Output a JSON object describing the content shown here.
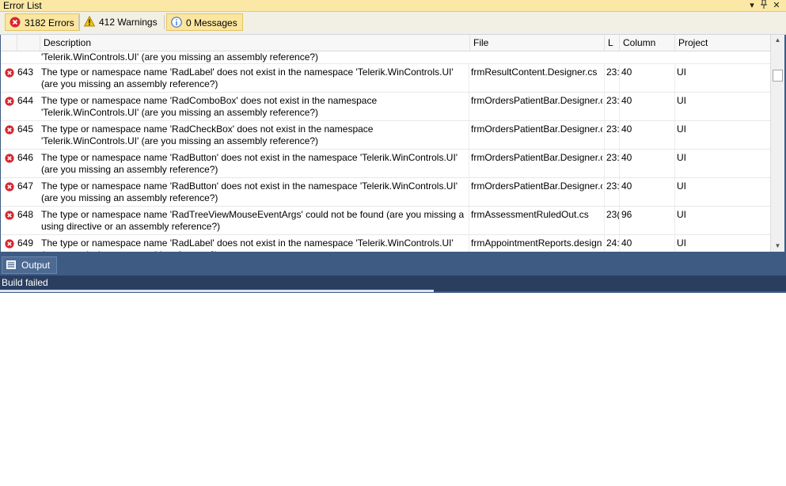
{
  "window": {
    "title": "Error List"
  },
  "toolbar": {
    "errors_label": "3182 Errors",
    "warnings_label": "412 Warnings",
    "messages_label": "0 Messages"
  },
  "columns": {
    "description": "Description",
    "file": "File",
    "line": "L",
    "column": "Column",
    "project": "Project"
  },
  "partial_row": {
    "description_line2": "'Telerik.WinControls.UI' (are you missing an assembly reference?)"
  },
  "rows": [
    {
      "num": "643",
      "description": "The type or namespace name 'RadLabel' does not exist in the namespace 'Telerik.WinControls.UI' (are you missing an assembly reference?)",
      "file": "frmResultContent.Designer.cs",
      "line": "23:",
      "column": "40",
      "project": "UI"
    },
    {
      "num": "644",
      "description": "The type or namespace name 'RadComboBox' does not exist in the namespace 'Telerik.WinControls.UI' (are you missing an assembly reference?)",
      "file": "frmOrdersPatientBar.Designer.c",
      "line": "23:",
      "column": "40",
      "project": "UI"
    },
    {
      "num": "645",
      "description": "The type or namespace name 'RadCheckBox' does not exist in the namespace 'Telerik.WinControls.UI' (are you missing an assembly reference?)",
      "file": "frmOrdersPatientBar.Designer.c",
      "line": "23:",
      "column": "40",
      "project": "UI"
    },
    {
      "num": "646",
      "description": "The type or namespace name 'RadButton' does not exist in the namespace 'Telerik.WinControls.UI' (are you missing an assembly reference?)",
      "file": "frmOrdersPatientBar.Designer.c",
      "line": "23:",
      "column": "40",
      "project": "UI"
    },
    {
      "num": "647",
      "description": "The type or namespace name 'RadButton' does not exist in the namespace 'Telerik.WinControls.UI' (are you missing an assembly reference?)",
      "file": "frmOrdersPatientBar.Designer.c",
      "line": "23:",
      "column": "40",
      "project": "UI"
    },
    {
      "num": "648",
      "description": "The type or namespace name 'RadTreeViewMouseEventArgs' could not be found (are you missing a using directive or an assembly reference?)",
      "file": "frmAssessmentRuledOut.cs",
      "line": "23(",
      "column": "96",
      "project": "UI"
    },
    {
      "num": "649",
      "description": "The type or namespace name 'RadLabel' does not exist in the namespace 'Telerik.WinControls.UI' (are you missing an assembly reference?)",
      "file": "frmAppointmentReports.design",
      "line": "24:",
      "column": "40",
      "project": "UI"
    }
  ],
  "output_tab": {
    "label": "Output"
  },
  "status": {
    "text": "Build failed"
  },
  "colors": {
    "error": "#d7262e",
    "warning": "#f5c400",
    "info": "#3a73c7",
    "accent": "#3e5b84"
  }
}
